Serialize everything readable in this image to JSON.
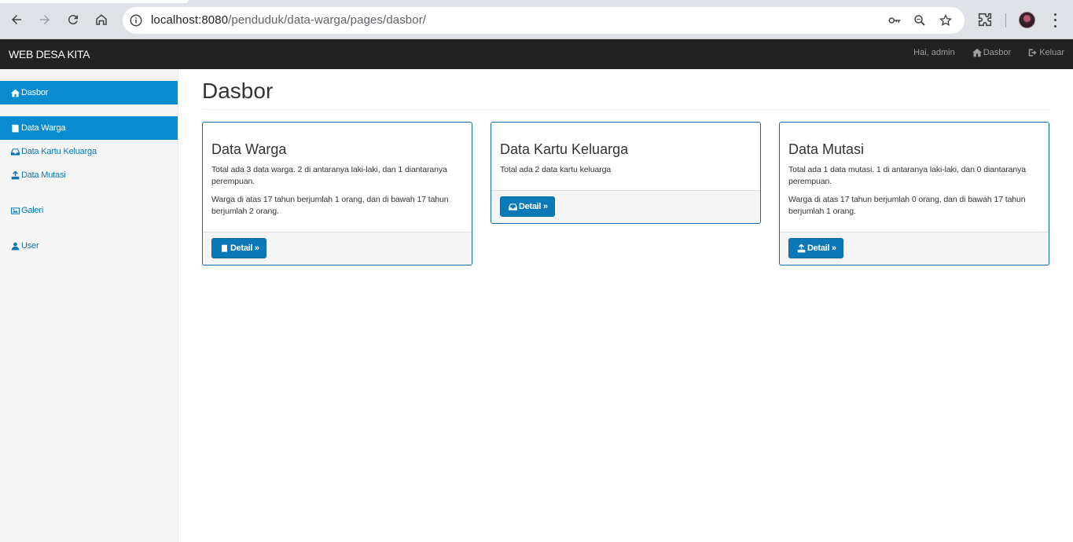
{
  "browser": {
    "url_host": "localhost:8080",
    "url_path": "/penduduk/data-warga/pages/dasbor/"
  },
  "navbar": {
    "brand": "WEB DESA KITA",
    "greeting": "Hai, admin",
    "dasbor_label": "Dasbor",
    "keluar_label": "Keluar"
  },
  "sidebar": {
    "items": [
      {
        "label": "Dasbor",
        "icon": "home-icon"
      },
      {
        "label": "Data Warga",
        "icon": "book-icon"
      },
      {
        "label": "Data Kartu Keluarga",
        "icon": "inbox-icon"
      },
      {
        "label": "Data Mutasi",
        "icon": "export-icon"
      },
      {
        "label": "Galeri",
        "icon": "picture-icon"
      },
      {
        "label": "User",
        "icon": "user-icon"
      }
    ]
  },
  "main": {
    "title": "Dasbor",
    "cards": [
      {
        "title": "Data Warga",
        "text1": "Total ada 3 data warga. 2 di antaranya laki-laki, dan 1 diantaranya perempuan.",
        "text2": "Warga di atas 17 tahun berjumlah 1 orang, dan di bawah 17 tahun berjumlah 2 orang.",
        "button": "Detail »"
      },
      {
        "title": "Data Kartu Keluarga",
        "text1": "Total ada 2 data kartu keluarga",
        "button": "Detail »"
      },
      {
        "title": "Data Mutasi",
        "text1": "Total ada 1 data mutasi. 1 di antaranya laki-laki, dan 0 diantaranya perempuan.",
        "text2": "Warga di atas 17 tahun berjumlah 0 orang, dan di bawah 17 tahun berjumlah 1 orang.",
        "button": "Detail »"
      }
    ]
  },
  "colors": {
    "navbar_bg": "#222222",
    "sidebar_active": "#0b8ccf",
    "link": "#0a77b5",
    "button": "#0b78b7",
    "card_border": "#0b6fa9"
  }
}
